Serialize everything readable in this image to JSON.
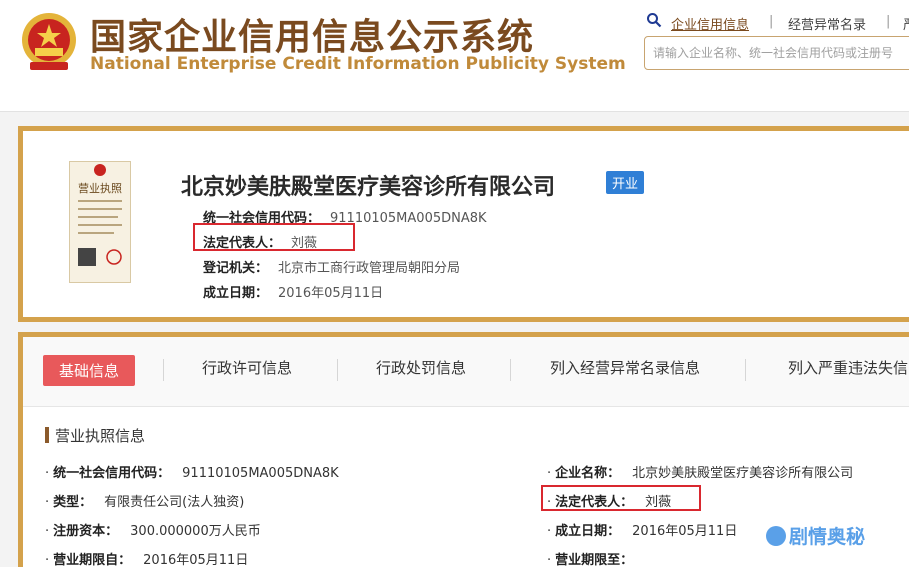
{
  "header": {
    "title_cn": "国家企业信用信息公示系统",
    "title_en": "National Enterprise Credit Information Publicity System",
    "nav": [
      "企业信用信息",
      "经营异常名录",
      "严"
    ],
    "search_placeholder": "请输入企业名称、统一社会信用代码或注册号"
  },
  "company": {
    "name": "北京妙美肤殿堂医疗美容诊所有限公司",
    "status": "开业",
    "license_caption": "营业执照",
    "info": [
      {
        "label": "统一社会信用代码：",
        "value": "91110105MA005DNA8K"
      },
      {
        "label": "法定代表人：",
        "value": "刘薇"
      },
      {
        "label": "登记机关：",
        "value": "北京市工商行政管理局朝阳分局"
      },
      {
        "label": "成立日期：",
        "value": "2016年05月11日"
      }
    ]
  },
  "tabs": [
    "基础信息",
    "行政许可信息",
    "行政处罚信息",
    "列入经营异常名录信息",
    "列入严重违法失信"
  ],
  "section": {
    "title": "营业执照信息",
    "left": [
      {
        "label": "统一社会信用代码：",
        "value": "91110105MA005DNA8K"
      },
      {
        "label": "类型：",
        "value": "有限责任公司(法人独资)"
      },
      {
        "label": "注册资本：",
        "value": "300.000000万人民币"
      },
      {
        "label": "营业期限自：",
        "value": "2016年05月11日"
      }
    ],
    "right": [
      {
        "label": "企业名称：",
        "value": "北京妙美肤殿堂医疗美容诊所有限公司"
      },
      {
        "label": "法定代表人：",
        "value": "刘薇"
      },
      {
        "label": "成立日期：",
        "value": "2016年05月11日"
      },
      {
        "label": "营业期限至：",
        "value": ""
      }
    ]
  },
  "watermark": "剧情奥秘",
  "colors": {
    "brand": "#7a4a1f",
    "border": "#d4a24c",
    "tab_active": "#e8595b",
    "badge": "#2f7fd6",
    "highlight": "#d9282f"
  }
}
